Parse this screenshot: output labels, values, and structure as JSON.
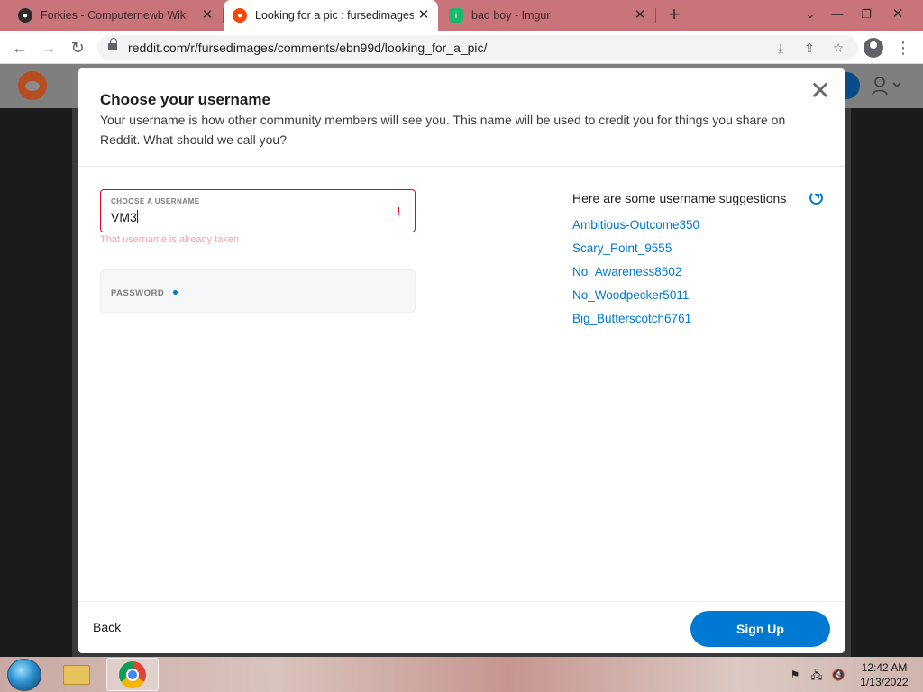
{
  "browser": {
    "tabs": [
      {
        "title": "Forkies - Computernewb Wiki",
        "active": false
      },
      {
        "title": "Looking for a pic : fursedimages",
        "active": true
      },
      {
        "title": "bad boy - Imgur",
        "active": false
      }
    ],
    "url": "reddit.com/r/fursedimages/comments/ebn99d/looking_for_a_pic/"
  },
  "modal": {
    "title": "Choose your username",
    "description": "Your username is how other community members will see you. This name will be used to credit you for things you share on Reddit. What should we call you?",
    "username_label": "Choose a username",
    "username_value": "VM3",
    "username_error": "That username is already taken",
    "password_label": "Password",
    "suggestions_title": "Here are some username suggestions",
    "suggestions": [
      "Ambitious-Outcome350",
      "Scary_Point_9555",
      "No_Awareness8502",
      "No_Woodpecker5011",
      "Big_Butterscotch6761"
    ],
    "back_label": "Back",
    "signup_label": "Sign Up"
  },
  "taskbar": {
    "time": "12:42 AM",
    "date": "1/13/2022"
  },
  "colors": {
    "accent": "#0079d3",
    "error": "#ea0027",
    "tabstrip": "#c9737a"
  }
}
